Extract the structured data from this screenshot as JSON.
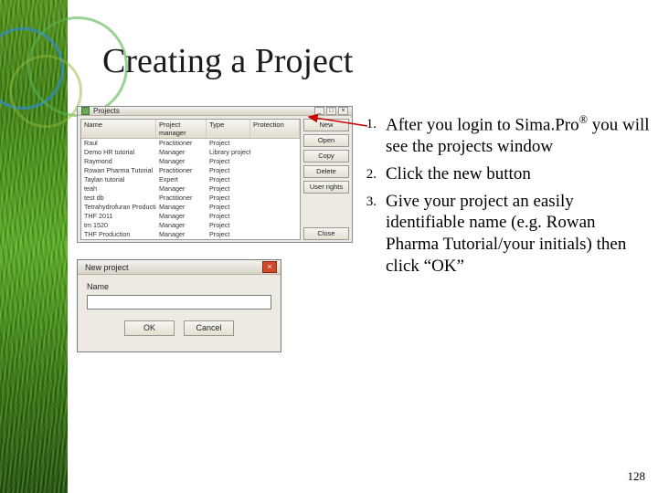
{
  "title": "Creating a Project",
  "projects_window": {
    "title": "Projects",
    "columns": [
      "Name",
      "Project manager",
      "Type",
      "Protection"
    ],
    "rows": [
      [
        "Raul",
        "Practitioner",
        "Project",
        ""
      ],
      [
        "Demo  HR tutorial",
        "Manager",
        "Library project",
        ""
      ],
      [
        "Raymond",
        "Manager",
        "Project",
        ""
      ],
      [
        "Rowan Pharma Tutorial",
        "Practitioner",
        "Project",
        ""
      ],
      [
        "Taylan tutorial",
        "Expert",
        "Project",
        ""
      ],
      [
        "teah",
        "Manager",
        "Project",
        ""
      ],
      [
        "test db",
        "Practitioner",
        "Project",
        ""
      ],
      [
        "Tetrahydrofuran Production",
        "Manager",
        "Project",
        ""
      ],
      [
        "THF 2011",
        "Manager",
        "Project",
        ""
      ],
      [
        "tm 1520",
        "Manager",
        "Project",
        ""
      ],
      [
        "THF Production",
        "Manager",
        "Project",
        ""
      ]
    ],
    "buttons": {
      "new": "New",
      "open": "Open",
      "copy": "Copy",
      "delete": "Delete",
      "user_rights": "User rights",
      "close": "Close"
    }
  },
  "new_project_dialog": {
    "title": "New project",
    "name_label": "Name",
    "name_value": "",
    "ok": "OK",
    "cancel": "Cancel"
  },
  "instructions": {
    "n1": "1.",
    "t1_a": "After you login to Sima.Pro",
    "t1_reg": "®",
    "t1_b": " you will see the projects window",
    "n2": "2.",
    "t2": "Click the new button",
    "n3": "3.",
    "t3": "Give your project an easily identifiable name (e.g. Rowan Pharma Tutorial/your initials) then click “OK”"
  },
  "page_number": "128"
}
